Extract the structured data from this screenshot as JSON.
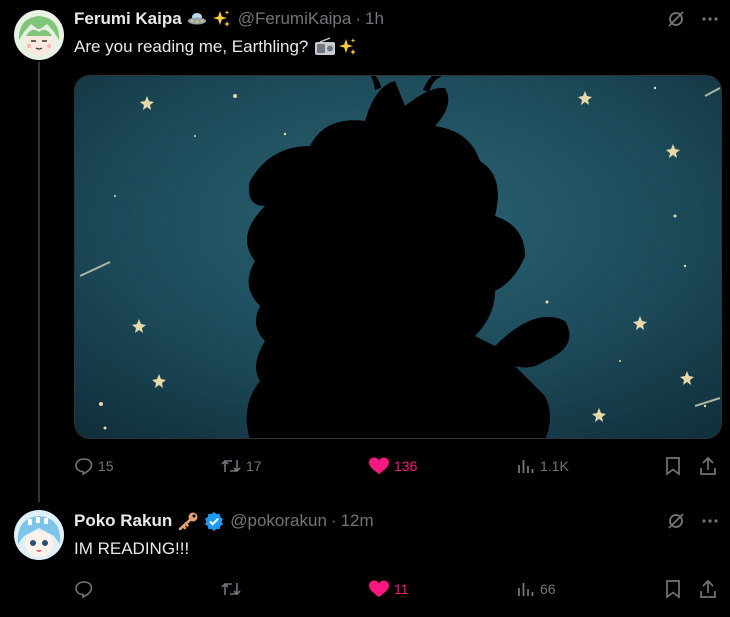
{
  "colors": {
    "background": "#000000",
    "text": "#e7e9ea",
    "muted": "#71767b",
    "like": "#f91880",
    "verified": "#1d9bf0",
    "media_bg": "#1f4a5a"
  },
  "tweets": [
    {
      "author": "Ferumi Kaipa",
      "emojis": [
        "ufo-icon",
        "sparkles-icon"
      ],
      "handle": "@FerumiKaipa",
      "dot": "·",
      "time": "1h",
      "text": "Are you reading me, Earthling?",
      "text_emojis": [
        "radio-icon",
        "sparkles-icon"
      ],
      "media": "silhouette-starry-sky-image",
      "stats": {
        "replies": "15",
        "retweets": "17",
        "likes": "136",
        "views": "1.1K"
      }
    },
    {
      "author": "Poko Rakun",
      "emojis": [
        "key-icon",
        "verified-badge-icon"
      ],
      "handle": "@pokorakun",
      "dot": "·",
      "time": "12m",
      "text": "IM READING!!!",
      "stats": {
        "replies": "",
        "retweets": "",
        "likes": "11",
        "views": "66"
      }
    }
  ]
}
